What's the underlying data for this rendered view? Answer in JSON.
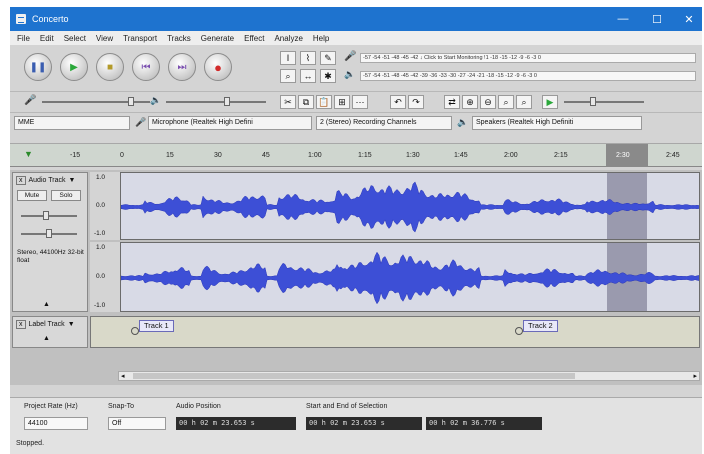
{
  "window": {
    "title": "Concerto"
  },
  "menu": [
    "File",
    "Edit",
    "Select",
    "View",
    "Transport",
    "Tracks",
    "Generate",
    "Effect",
    "Analyze",
    "Help"
  ],
  "transport": [
    {
      "name": "pause",
      "glyph": "❚❚",
      "color": "#3a5db0"
    },
    {
      "name": "play",
      "glyph": "▶",
      "color": "#2aa83a"
    },
    {
      "name": "stop",
      "glyph": "■",
      "color": "#b39a2a"
    },
    {
      "name": "skip-start",
      "glyph": "⏮",
      "color": "#7b4fb0"
    },
    {
      "name": "skip-end",
      "glyph": "⏭",
      "color": "#7b4fb0"
    },
    {
      "name": "record",
      "glyph": "●",
      "color": "#d22b2b"
    }
  ],
  "meters": {
    "record_meter": "-57 -54 -51 -48 -45 -42 ↓ Click to Start Monitoring !1 -18 -15 -12 -9 -6 -3 0",
    "playback_meter": "-57 -54 -51 -48 -45 -42 -39 -36 -33 -30 -27 -24 -21 -18 -15 -12 -9 -6 -3 0"
  },
  "device": {
    "host": "MME",
    "mic": "Microphone (Realtek High Defini",
    "channels": "2 (Stereo) Recording Channels",
    "speaker": "Speakers (Realtek High Definiti"
  },
  "timeline": {
    "ticks": [
      "-15",
      "0",
      "15",
      "30",
      "45",
      "1:00",
      "1:15",
      "1:30",
      "1:45",
      "2:00",
      "2:15",
      "2:30",
      "2:45"
    ]
  },
  "audio_track": {
    "name": "Audio Track",
    "mute": "Mute",
    "solo": "Solo",
    "info": "Stereo, 44100Hz 32-bit float",
    "scale": [
      "1.0",
      "0.0",
      "-1.0"
    ]
  },
  "label_track": {
    "name": "Label Track",
    "labels": [
      "Track 1",
      "Track 2"
    ]
  },
  "bottom": {
    "project_rate_label": "Project Rate (Hz)",
    "project_rate_value": "44100",
    "snap_to_label": "Snap-To",
    "snap_to_value": "Off",
    "audio_position_label": "Audio Position",
    "audio_position_value": "00 h 02 m 23.653 s",
    "selection_label": "Start and End of Selection",
    "selection_start": "00 h 02 m 23.653 s",
    "selection_end": "00 h 02 m 36.776 s",
    "status": "Stopped."
  }
}
